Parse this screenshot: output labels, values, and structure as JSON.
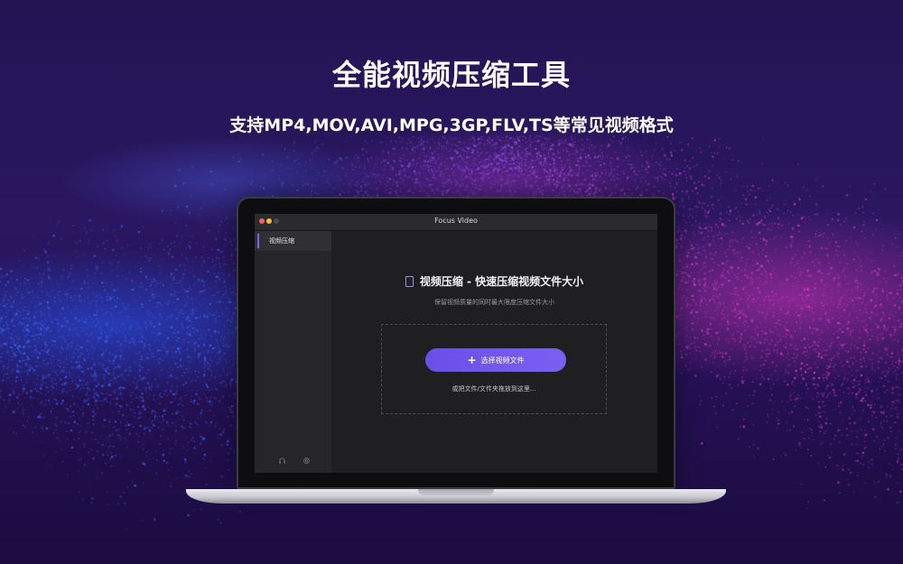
{
  "banner": {
    "title": "全能视频压缩工具",
    "subtitle": "支持MP4,MOV,AVI,MPG,3GP,FLV,TS等常见视频格式"
  },
  "window": {
    "title": "Focus Video"
  },
  "sidebar": {
    "items": [
      {
        "label": "视频压缩",
        "active": true
      }
    ],
    "footer_icons": [
      "headphones-icon",
      "settings-icon"
    ]
  },
  "main": {
    "title": "视频压缩 - 快速压缩视频文件大小",
    "subtitle": "保留视频质量的同时最大限度压缩文件大小",
    "select_button": "选择视频文件",
    "drop_hint": "或把文件/文件夹拖放到这里..."
  },
  "colors": {
    "accent": "#7a60f2",
    "background": "#241453",
    "particle_blue": "#3b6cff",
    "particle_pink": "#e43fd0"
  }
}
